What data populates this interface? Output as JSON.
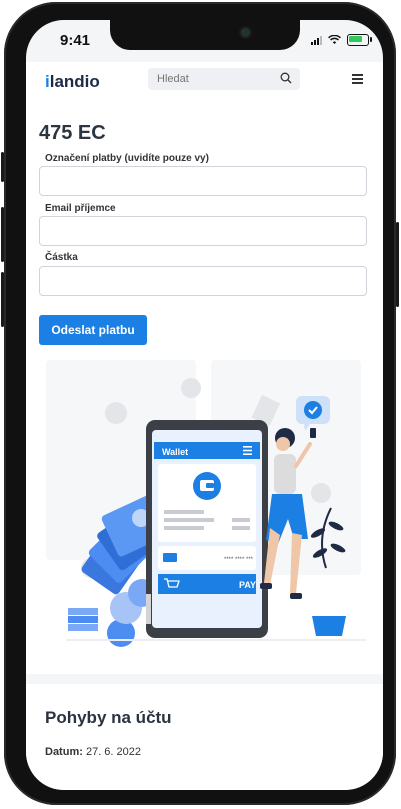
{
  "status_bar": {
    "time": "9:41"
  },
  "header": {
    "logo_prefix": "i",
    "logo_rest": "landio",
    "search_placeholder": "Hledat"
  },
  "wallet": {
    "balance": "475 EC",
    "form": {
      "field1_label": "Označení platby (uvidíte pouze vy)",
      "field2_label": "Email příjemce",
      "field3_label": "Částka",
      "submit_label": "Odeslat platbu"
    }
  },
  "illustration": {
    "wallet_title": "Wallet",
    "card_number": "**** **** ***",
    "pay_label": "PAY"
  },
  "movements": {
    "title": "Pohyby na účtu",
    "date_label": "Datum:",
    "date_value": "27. 6. 2022"
  },
  "colors": {
    "accent": "#1b7fe3",
    "background": "#f4f5f7",
    "text_dark": "#2c3640"
  }
}
